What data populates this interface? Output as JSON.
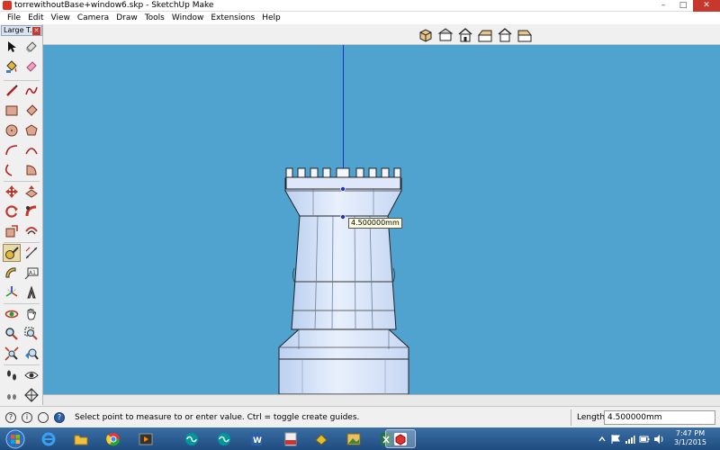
{
  "window": {
    "title": "torrewithoutBase+window6.skp - SketchUp Make",
    "minimize_glyph": "–",
    "maximize_glyph": "□",
    "close_glyph": "✕"
  },
  "menu": [
    "File",
    "Edit",
    "View",
    "Camera",
    "Draw",
    "Tools",
    "Window",
    "Extensions",
    "Help"
  ],
  "palette": {
    "title": "Large T...",
    "close_glyph": "✕",
    "tools": [
      {
        "name": "select-tool"
      },
      {
        "name": "eraser-tool"
      },
      {
        "name": "paint-bucket-tool"
      },
      {
        "name": "make-component-tool"
      },
      {
        "name": "line-tool"
      },
      {
        "name": "freehand-tool"
      },
      {
        "name": "rectangle-tool"
      },
      {
        "name": "rotated-rectangle-tool"
      },
      {
        "name": "circle-tool"
      },
      {
        "name": "polygon-tool"
      },
      {
        "name": "arc-tool"
      },
      {
        "name": "two-point-arc-tool"
      },
      {
        "name": "three-point-arc-tool"
      },
      {
        "name": "pie-tool"
      },
      {
        "name": "move-tool"
      },
      {
        "name": "push-pull-tool"
      },
      {
        "name": "rotate-tool"
      },
      {
        "name": "follow-me-tool"
      },
      {
        "name": "scale-tool"
      },
      {
        "name": "offset-tool"
      },
      {
        "name": "tape-measure-tool",
        "selected": true
      },
      {
        "name": "dimension-tool"
      },
      {
        "name": "protractor-tool"
      },
      {
        "name": "text-tool"
      },
      {
        "name": "axes-tool"
      },
      {
        "name": "3d-text-tool"
      },
      {
        "name": "orbit-tool"
      },
      {
        "name": "pan-tool"
      },
      {
        "name": "zoom-tool"
      },
      {
        "name": "zoom-window-tool"
      },
      {
        "name": "zoom-extents-tool"
      },
      {
        "name": "previous-view-tool"
      },
      {
        "name": "walk-tool"
      },
      {
        "name": "look-around-tool"
      },
      {
        "name": "position-camera-tool"
      },
      {
        "name": "section-plane-tool"
      }
    ]
  },
  "views_toolbar": [
    "iso-view",
    "top-view",
    "front-view",
    "right-view",
    "back-view",
    "left-view"
  ],
  "viewport": {
    "measure_tooltip": "4.500000mm",
    "background_color": "#4fa3ce",
    "axis_color": "#1e32c8"
  },
  "statusbar": {
    "icon1": "?",
    "icon2": "i",
    "icon3": "?",
    "hint": "Select point to measure to or enter value.  Ctrl = toggle create guides.",
    "vcb_label": "Length",
    "vcb_value": "4.500000mm"
  },
  "taskbar": {
    "apps": [
      "ie",
      "explorer",
      "chrome",
      "media-player",
      "arduino",
      "arduino-2",
      "word",
      "pdf-creator",
      "cura",
      "photo",
      "excel",
      "sketchup"
    ],
    "time": "7:47 PM",
    "date": "3/1/2015"
  }
}
